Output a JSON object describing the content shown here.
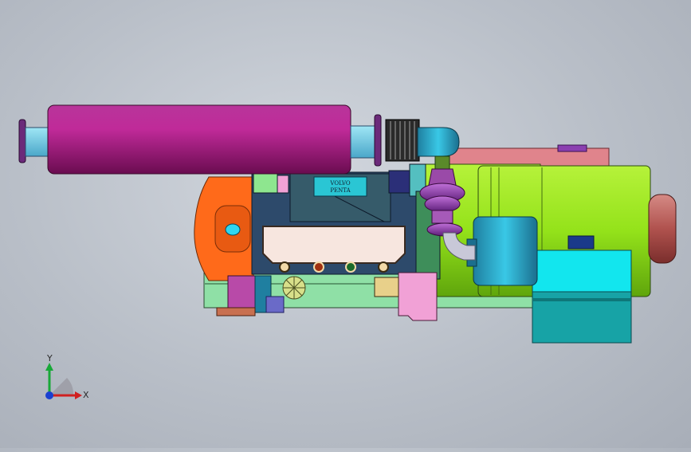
{
  "model": {
    "brand_plate_line1": "VOLVO",
    "brand_plate_line2": "PENTA"
  },
  "triad": {
    "x_label": "X",
    "y_label": "Y"
  },
  "colors": {
    "background": "#bcc2ca",
    "exhaust_pipe": "#a0127a",
    "engine_block": "#2d4a6b",
    "generator": "#9ee61c",
    "radiator_side": "#ff6a1a",
    "control_box": "#19a9b8",
    "base_frame": "#8fe0a6"
  }
}
